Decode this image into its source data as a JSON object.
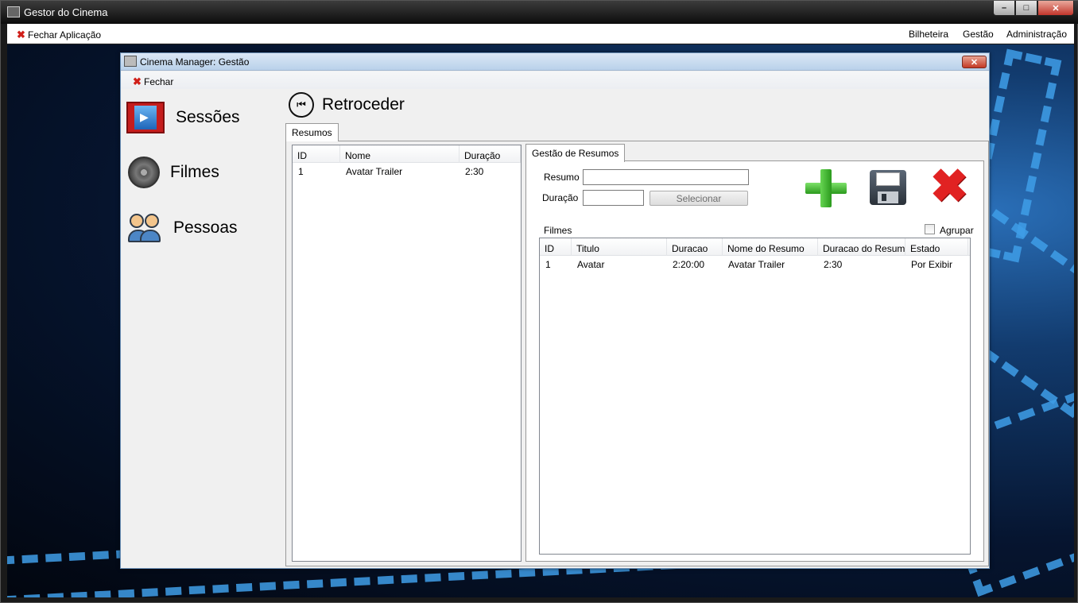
{
  "outer_window": {
    "title": "Gestor do Cinema",
    "menu": {
      "close_app": "Fechar Aplicação",
      "right_items": [
        "Bilheteira",
        "Gestão",
        "Administração"
      ]
    }
  },
  "child_window": {
    "title": "Cinema Manager: Gestão",
    "menu": {
      "close": "Fechar"
    }
  },
  "nav": {
    "items": [
      {
        "label": "Sessões",
        "icon": "film-screen-icon"
      },
      {
        "label": "Filmes",
        "icon": "film-reel-icon"
      },
      {
        "label": "Pessoas",
        "icon": "people-icon"
      }
    ]
  },
  "back_button": {
    "label": "Retroceder"
  },
  "resumos_tab": {
    "label": "Resumos",
    "columns": [
      "ID",
      "Nome",
      "Duração"
    ],
    "rows": [
      [
        "1",
        "Avatar Trailer",
        "2:30"
      ]
    ]
  },
  "gestao_tab": {
    "label": "Gestão de Resumos",
    "form": {
      "resumo_label": "Resumo",
      "resumo_value": "",
      "duracao_label": "Duração",
      "duracao_value": "",
      "select_button": "Selecionar"
    },
    "filmes_label": "Filmes",
    "group_checkbox": {
      "label": "Agrupar",
      "checked": false
    },
    "columns": [
      "ID",
      "Titulo",
      "Duracao",
      "Nome do Resumo",
      "Duracao do Resumo",
      "Estado"
    ],
    "rows": [
      [
        "1",
        "Avatar",
        "2:20:00",
        "Avatar Trailer",
        "2:30",
        "Por Exibir"
      ]
    ],
    "actions": [
      "add-icon",
      "save-icon",
      "delete-icon"
    ]
  },
  "colors": {
    "close_x": "#d0201a",
    "add_green": "#2b9a1d",
    "delete_red": "#e12222"
  }
}
